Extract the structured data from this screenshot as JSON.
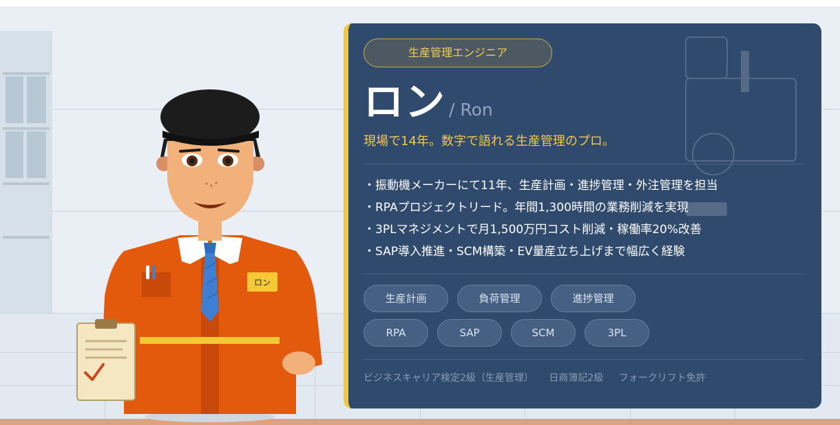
{
  "card": {
    "role": "生産管理エンジニア",
    "name_jp": "ロン",
    "name_en": "/ Ron",
    "tagline": "現場で14年。数字で語れる生産管理のプロ。",
    "bullets": [
      "・振動機メーカーにて11年、生産計画・進捗管理・外注管理を担当",
      "・RPAプロジェクトリード。年間1,300時間の業務削減を実現",
      "・3PLマネジメントで月1,500万円コスト削減・稼働率20%改善",
      "・SAP導入推進・SCM構築・EV量産立ち上げまで幅広く経験"
    ],
    "skill_tags": [
      "生産計画",
      "負荷管理",
      "進捗管理"
    ],
    "tool_tags": [
      "RPA",
      "SAP",
      "SCM",
      "3PL"
    ],
    "certifications": [
      "ビジネスキャリア検定2級（生産管理）",
      "日商簿記2級",
      "フォークリフト免許"
    ]
  },
  "character": {
    "name_badge": "ロン"
  },
  "colors": {
    "card_bg": "#2f4a6d",
    "accent_yellow": "#f5c935",
    "uniform_orange": "#e45a0c",
    "tie_blue": "#3f7fd3"
  },
  "icons": [
    "clipboard-check-icon",
    "name-badge-icon"
  ]
}
